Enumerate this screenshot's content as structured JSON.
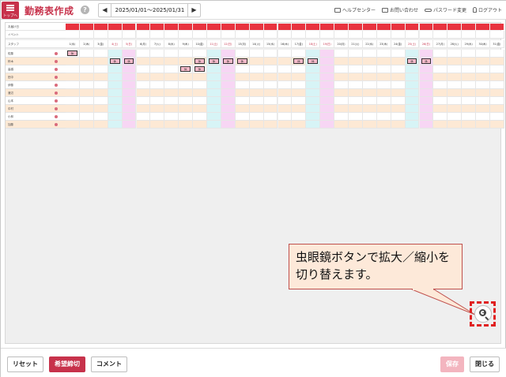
{
  "header": {
    "menu_label": "トップへ",
    "title": "勤務表作成",
    "help": "?",
    "date_range": "2025/01/01～2025/01/31",
    "links": [
      {
        "icon": "book-icon",
        "label": "ヘルプセンター"
      },
      {
        "icon": "mail-icon",
        "label": "お問い合わせ"
      },
      {
        "icon": "key-icon",
        "label": "パスワード変更"
      },
      {
        "icon": "person-icon",
        "label": "ログアウト"
      }
    ]
  },
  "grid": {
    "top_rows": [
      "お届け日",
      "イベント"
    ],
    "header_label": "スタッフ",
    "staff": [
      "佐藤",
      "鈴木",
      "高橋",
      "田中",
      "伊藤",
      "渡辺",
      "山本",
      "中村",
      "小林",
      "加藤"
    ],
    "days": [
      "1(水)",
      "2(木)",
      "3(金)",
      "4(土)",
      "5(日)",
      "6(月)",
      "7(火)",
      "8(水)",
      "9(木)",
      "10(金)",
      "11(土)",
      "12(日)",
      "13(月)",
      "14(火)",
      "15(水)",
      "16(木)",
      "17(金)",
      "18(土)",
      "19(日)",
      "20(月)",
      "21(火)",
      "22(水)",
      "23(木)",
      "24(金)",
      "25(土)",
      "26(日)",
      "27(月)",
      "28(火)",
      "29(水)",
      "30(木)",
      "31(金)"
    ],
    "shift_label": "休"
  },
  "callout": {
    "text": "虫眼鏡ボタンで拡大／縮小を切り替えます。"
  },
  "footer": {
    "reset": "リセット",
    "wish_deadline": "希望締切",
    "comment": "コメント",
    "save": "保存",
    "close": "閉じる"
  },
  "colors": {
    "accent": "#c7324b",
    "weekend_blue": "#d7f4f6",
    "weekend_pink": "#f7d6f4",
    "row_alt": "#fde9d5"
  }
}
